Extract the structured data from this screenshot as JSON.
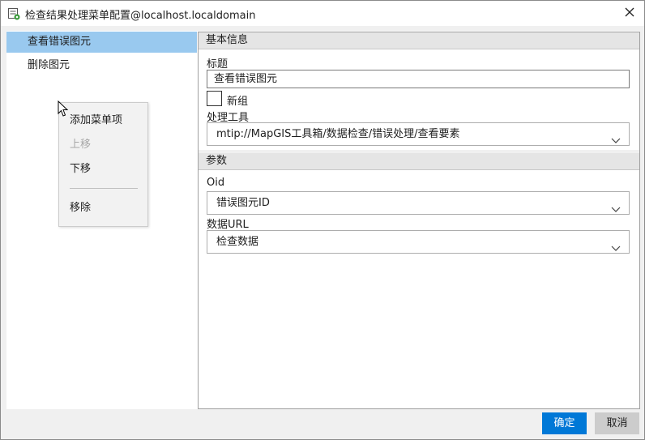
{
  "window": {
    "title": "检查结果处理菜单配置@localhost.localdomain",
    "icons": {
      "app": "config-window-icon",
      "close": "close-icon"
    }
  },
  "left_list": {
    "items": [
      {
        "label": "查看错误图元",
        "selected": true
      },
      {
        "label": "删除图元",
        "selected": false
      }
    ],
    "selected_color": "#99c9ef"
  },
  "context_menu": {
    "items": [
      {
        "label": "添加菜单项",
        "enabled": true
      },
      {
        "label": "上移",
        "enabled": false
      },
      {
        "label": "下移",
        "enabled": true
      },
      {
        "label": "移除",
        "enabled": true
      }
    ]
  },
  "basic_info": {
    "header": "基本信息",
    "title_label": "标题",
    "title_value": "查看错误图元",
    "new_group_label": "新组",
    "new_group_checked": false,
    "tool_label": "处理工具",
    "tool_value": "mtip://MapGIS工具箱/数据检查/错误处理/查看要素"
  },
  "params": {
    "header": "参数",
    "oid_label": "Oid",
    "oid_value": "错误图元ID",
    "url_label": "数据URL",
    "url_value": "检查数据"
  },
  "buttons": {
    "ok": "确定",
    "cancel": "取消",
    "accent": "#0078d7"
  }
}
